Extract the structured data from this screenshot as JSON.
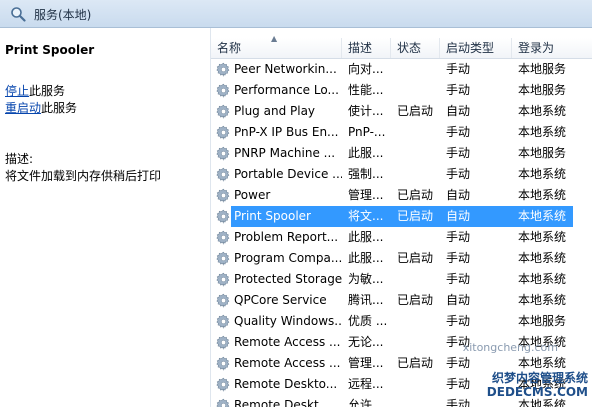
{
  "window": {
    "title": "服务(本地)",
    "icon": "search-icon"
  },
  "left_pane": {
    "service_name": "Print Spooler",
    "stop_link": "停止",
    "stop_suffix": "此服务",
    "restart_link": "重启动",
    "restart_suffix": "此服务",
    "description_label": "描述:",
    "description_text": "将文件加载到内存供稍后打印"
  },
  "columns": {
    "name": "名称",
    "description": "描述",
    "status": "状态",
    "startup_type": "启动类型",
    "logon_as": "登录为"
  },
  "services": [
    {
      "name": "Peer Networkin...",
      "description": "向对...",
      "status": "",
      "startup": "手动",
      "logon": "本地服务"
    },
    {
      "name": "Performance Lo...",
      "description": "性能...",
      "status": "",
      "startup": "手动",
      "logon": "本地服务"
    },
    {
      "name": "Plug and Play",
      "description": "使计...",
      "status": "已启动",
      "startup": "自动",
      "logon": "本地系统"
    },
    {
      "name": "PnP-X IP Bus En...",
      "description": "PnP-...",
      "status": "",
      "startup": "手动",
      "logon": "本地系统"
    },
    {
      "name": "PNRP Machine ...",
      "description": "此服...",
      "status": "",
      "startup": "手动",
      "logon": "本地服务"
    },
    {
      "name": "Portable Device ...",
      "description": "强制...",
      "status": "",
      "startup": "手动",
      "logon": "本地系统"
    },
    {
      "name": "Power",
      "description": "管理...",
      "status": "已启动",
      "startup": "自动",
      "logon": "本地系统"
    },
    {
      "name": "Print Spooler",
      "description": "将文...",
      "status": "已启动",
      "startup": "自动",
      "logon": "本地系统",
      "selected": true
    },
    {
      "name": "Problem Report...",
      "description": "此服...",
      "status": "",
      "startup": "手动",
      "logon": "本地系统"
    },
    {
      "name": "Program Compa...",
      "description": "此服...",
      "status": "已启动",
      "startup": "手动",
      "logon": "本地系统"
    },
    {
      "name": "Protected Storage",
      "description": "为敏...",
      "status": "",
      "startup": "手动",
      "logon": "本地系统"
    },
    {
      "name": "QPCore Service",
      "description": "腾讯...",
      "status": "已启动",
      "startup": "自动",
      "logon": "本地系统"
    },
    {
      "name": "Quality Windows...",
      "description": "优质 ...",
      "status": "",
      "startup": "手动",
      "logon": "本地服务"
    },
    {
      "name": "Remote Access ...",
      "description": "无论...",
      "status": "",
      "startup": "手动",
      "logon": "本地系统"
    },
    {
      "name": "Remote Access ...",
      "description": "管理...",
      "status": "已启动",
      "startup": "手动",
      "logon": "本地系统"
    },
    {
      "name": "Remote Deskto...",
      "description": "远程...",
      "status": "",
      "startup": "手动",
      "logon": "本地系统"
    },
    {
      "name": "Remote Deskt...",
      "description": "允许...",
      "status": "",
      "startup": "手动",
      "logon": "本地系统"
    }
  ],
  "watermark": {
    "line0": "xitongcheng.com",
    "line1": "织梦内容管理系统",
    "line2": "DEDECMS.COM"
  },
  "colors": {
    "selection": "#3399ff",
    "link": "#0645ad"
  }
}
